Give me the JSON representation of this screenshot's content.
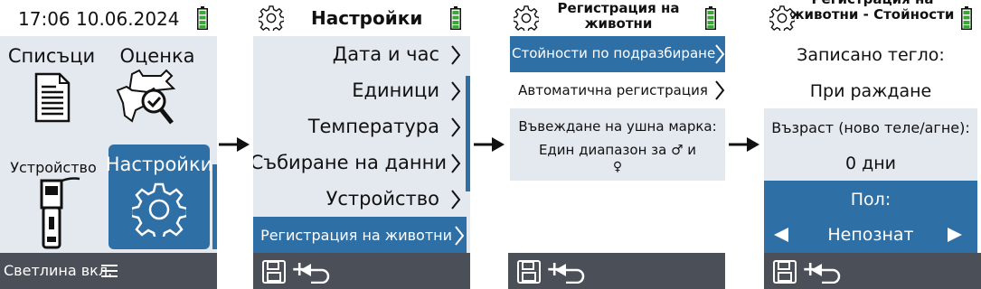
{
  "screen1": {
    "header": {
      "datetime": "17:06 10.06.2024"
    },
    "tiles": [
      {
        "label": "Списъци",
        "icon": "document-list-icon"
      },
      {
        "label": "Оценка",
        "icon": "animal-evaluation-icon"
      },
      {
        "label": "Устройство",
        "icon": "device-reader-icon"
      },
      {
        "label": "Настройки",
        "icon": "gear-icon",
        "selected": true
      }
    ],
    "footer": {
      "status": "Светлина вкл.",
      "icon": "menu-icon"
    }
  },
  "screen2": {
    "header": {
      "title": "Настройки",
      "icon": "gear-icon"
    },
    "items": [
      {
        "label": "Дата и час"
      },
      {
        "label": "Единици"
      },
      {
        "label": "Температура"
      },
      {
        "label": "Събиране на данни"
      },
      {
        "label": "Устройство"
      },
      {
        "label": "Регистрация на животни",
        "selected": true
      }
    ],
    "footer": {
      "icon": "save-return-icon",
      "plus": "+"
    }
  },
  "screen3": {
    "header": {
      "title_line1": "Регистрация на",
      "title_line2": "животни",
      "icon": "gear-icon"
    },
    "items": [
      {
        "label": "Стойности по подразбиране",
        "selected": true
      },
      {
        "label": "Автоматична регистрация"
      }
    ],
    "ear_tag": {
      "label": "Въвеждане на ушна марка:",
      "value_line1": "Един диапазон за ♂ и",
      "value_line2": "♀"
    },
    "footer": {
      "icon": "save-return-icon",
      "plus": "+"
    }
  },
  "screen4": {
    "header": {
      "title_line1": "Регистрация на",
      "title_line2": "животни - Стойности",
      "icon": "gear-icon"
    },
    "recorded_weight_label": "Записано тегло:",
    "recorded_weight_value": "При раждане",
    "age_label": "Възраст (ново теле/агне):",
    "age_value": "0 дни",
    "sex_label": "Пол:",
    "sex_value": "Непознат",
    "footer": {
      "icon": "save-return-icon",
      "plus": "+"
    }
  },
  "colors": {
    "accent": "#2e6fa6",
    "panel": "#e4e8ef",
    "footer": "#4b4f57",
    "battery": "#3aa635"
  }
}
